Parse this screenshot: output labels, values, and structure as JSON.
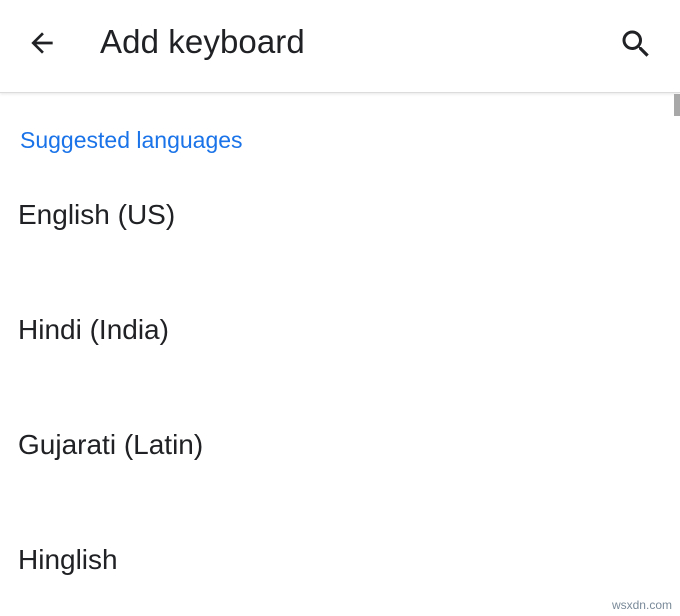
{
  "app_bar": {
    "back_icon": "arrow-back-icon",
    "title": "Add keyboard",
    "search_icon": "search-icon"
  },
  "section": {
    "header": "Suggested languages",
    "accent_color": "#1a73e8"
  },
  "languages": [
    {
      "label": "English (US)"
    },
    {
      "label": "Hindi (India)"
    },
    {
      "label": "Gujarati (Latin)"
    },
    {
      "label": "Hinglish"
    }
  ],
  "watermark": "wsxdn.com"
}
